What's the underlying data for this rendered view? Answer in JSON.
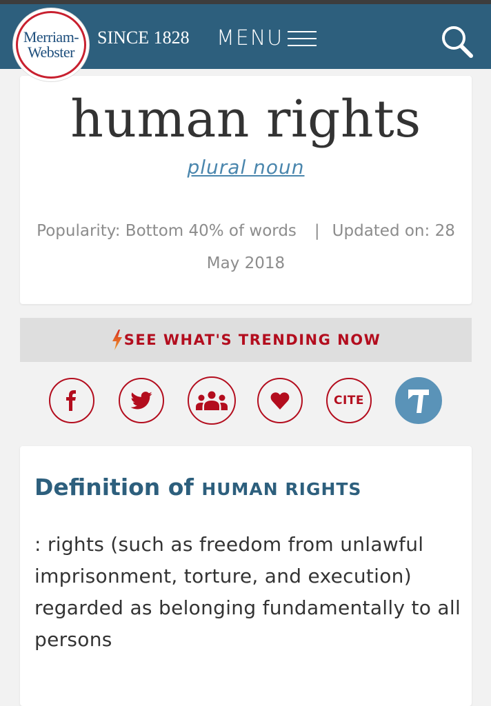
{
  "header": {
    "logo_line1": "Merriam-",
    "logo_line2": "Webster",
    "tagline": "SINCE 1828",
    "menu_label": "MENU",
    "search_icon": "search-icon"
  },
  "entry": {
    "headword": "human rights",
    "part_of_speech": "plural noun",
    "popularity": "Popularity: Bottom 40% of words",
    "separator": "|",
    "updated": "Updated on: 28 May 2018"
  },
  "trending": {
    "label": "SEE WHAT'S TRENDING NOW",
    "icon": "lightning-bolt-icon"
  },
  "share": {
    "buttons": [
      {
        "name": "facebook",
        "icon": "facebook-icon"
      },
      {
        "name": "twitter",
        "icon": "twitter-icon"
      },
      {
        "name": "community",
        "icon": "people-icon"
      },
      {
        "name": "save",
        "icon": "heart-icon"
      },
      {
        "name": "cite",
        "label": "CITE"
      },
      {
        "name": "thesaurus",
        "icon": "thesaurus-icon"
      }
    ]
  },
  "definition": {
    "title_prefix": "Definition of",
    "title_word": "HUMAN RIGHTS",
    "text": ": rights (such as freedom from unlawful imprisonment, torture, and execution) regarded as belonging fundamentally to all persons"
  },
  "colors": {
    "header_bg": "#2d5f7d",
    "accent_red": "#b30d1e",
    "link_blue": "#4a86ad",
    "thesaurus_blue": "#5a93b8"
  }
}
